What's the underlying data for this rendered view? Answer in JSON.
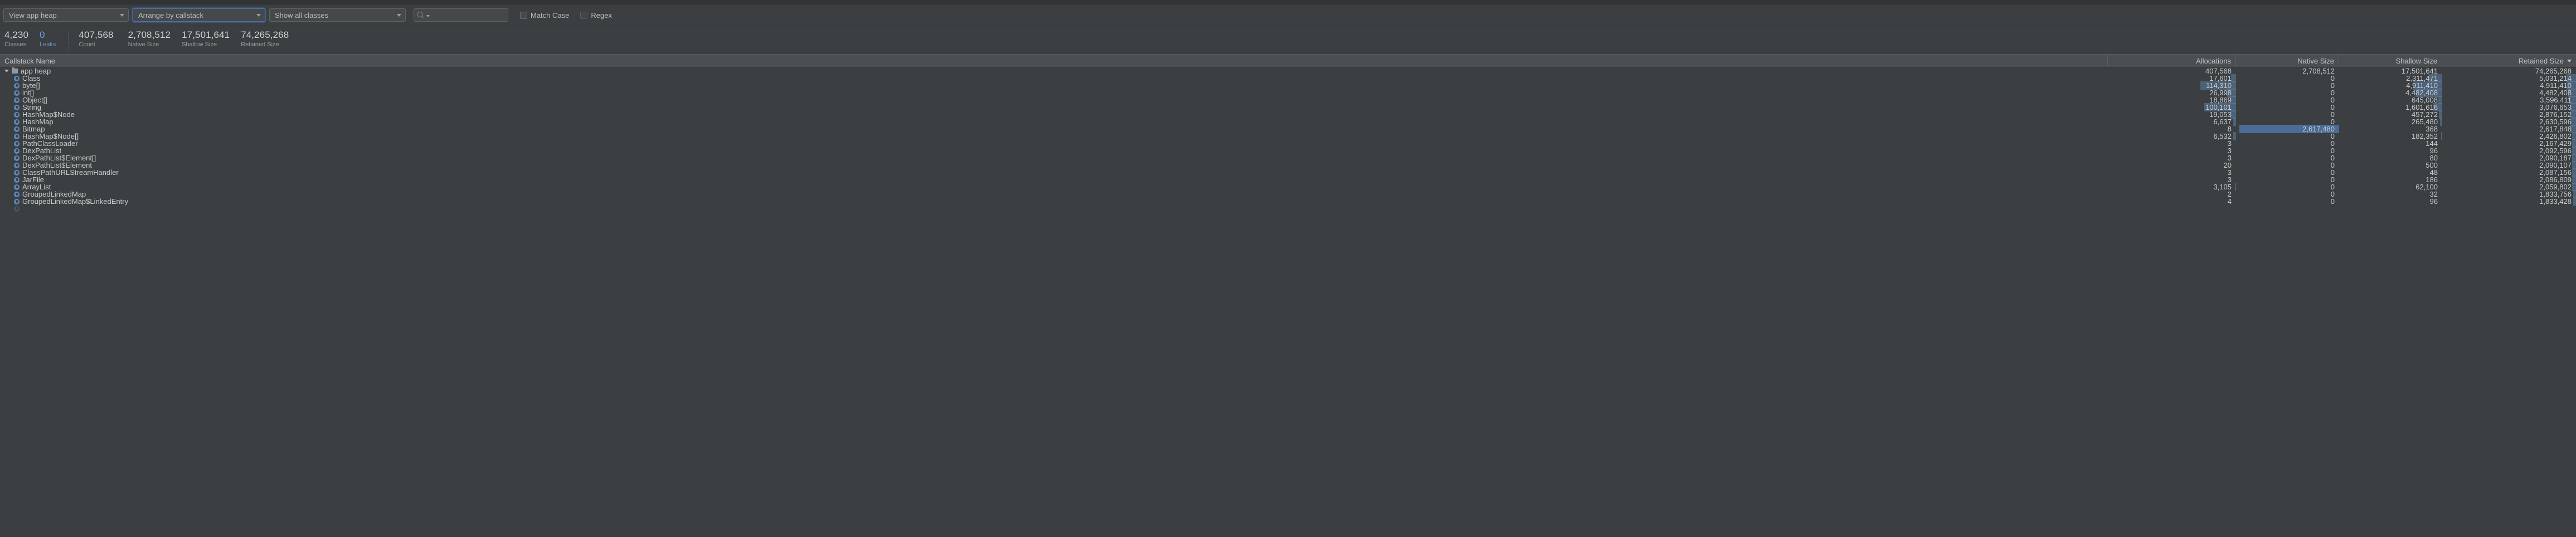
{
  "toolbar": {
    "heap_select": {
      "value": "View app heap",
      "icon": "chevron-down-icon"
    },
    "arrange_select": {
      "value": "Arrange by callstack",
      "icon": "chevron-down-icon"
    },
    "classes_select": {
      "value": "Show all classes",
      "icon": "chevron-down-icon"
    },
    "search": {
      "value": "",
      "placeholder": "",
      "icon": "search-icon"
    },
    "match_case": {
      "label": "Match Case",
      "checked": false
    },
    "regex": {
      "label": "Regex",
      "checked": false
    }
  },
  "stats": [
    {
      "value": "4,230",
      "label": "Classes",
      "accent": false
    },
    {
      "value": "0",
      "label": "Leaks",
      "accent": true
    },
    {
      "value": "407,568",
      "label": "Count",
      "accent": false
    },
    {
      "value": "2,708,512",
      "label": "Native Size",
      "accent": false
    },
    {
      "value": "17,501,641",
      "label": "Shallow Size",
      "accent": false
    },
    {
      "value": "74,265,268",
      "label": "Retained Size",
      "accent": false
    }
  ],
  "table": {
    "columns": [
      {
        "key": "name",
        "label": "Callstack Name",
        "align": "left",
        "sorted": false
      },
      {
        "key": "allocations",
        "label": "Allocations",
        "align": "right",
        "sorted": false
      },
      {
        "key": "native",
        "label": "Native Size",
        "align": "right",
        "sorted": false
      },
      {
        "key": "shallow",
        "label": "Shallow Size",
        "align": "right",
        "sorted": false
      },
      {
        "key": "retained",
        "label": "Retained Size",
        "align": "right",
        "sorted": true,
        "sort_dir": "desc"
      }
    ],
    "rows": [
      {
        "name": "app heap",
        "icon": "folder-icon",
        "depth": 0,
        "expanded": true,
        "allocations": "407,568",
        "native": "2,708,512",
        "shallow": "17,501,641",
        "retained": "74,265,268",
        "bars": {
          "allocations": 0,
          "native": 0,
          "shallow": 0,
          "retained": 0
        }
      },
      {
        "name": "Class",
        "icon": "class-icon",
        "depth": 1,
        "expanded": false,
        "allocations": "17,601",
        "native": "0",
        "shallow": "2,311,471",
        "retained": "5,031,214",
        "bars": {
          "allocations": 4,
          "native": 0,
          "shallow": 13,
          "retained": 7
        }
      },
      {
        "name": "byte[]",
        "icon": "class-icon",
        "depth": 1,
        "expanded": false,
        "allocations": "114,310",
        "native": "0",
        "shallow": "4,911,410",
        "retained": "4,911,410",
        "bars": {
          "allocations": 28,
          "native": 0,
          "shallow": 28,
          "retained": 7
        }
      },
      {
        "name": "int[]",
        "icon": "class-icon",
        "depth": 1,
        "expanded": false,
        "allocations": "26,998",
        "native": "0",
        "shallow": "4,482,408",
        "retained": "4,482,408",
        "bars": {
          "allocations": 7,
          "native": 0,
          "shallow": 26,
          "retained": 6
        }
      },
      {
        "name": "Object[]",
        "icon": "class-icon",
        "depth": 1,
        "expanded": false,
        "allocations": "18,869",
        "native": "0",
        "shallow": "645,008",
        "retained": "3,596,411",
        "bars": {
          "allocations": 5,
          "native": 0,
          "shallow": 4,
          "retained": 5
        }
      },
      {
        "name": "String",
        "icon": "class-icon",
        "depth": 1,
        "expanded": false,
        "allocations": "100,101",
        "native": "0",
        "shallow": "1,601,616",
        "retained": "3,076,653",
        "bars": {
          "allocations": 25,
          "native": 0,
          "shallow": 9,
          "retained": 4
        }
      },
      {
        "name": "HashMap$Node",
        "icon": "class-icon",
        "depth": 1,
        "expanded": false,
        "allocations": "19,053",
        "native": "0",
        "shallow": "457,272",
        "retained": "2,876,152",
        "bars": {
          "allocations": 5,
          "native": 0,
          "shallow": 3,
          "retained": 4
        }
      },
      {
        "name": "HashMap",
        "icon": "class-icon",
        "depth": 1,
        "expanded": false,
        "allocations": "6,637",
        "native": "0",
        "shallow": "265,480",
        "retained": "2,630,596",
        "bars": {
          "allocations": 2,
          "native": 0,
          "shallow": 2,
          "retained": 4
        }
      },
      {
        "name": "Bitmap",
        "icon": "class-icon",
        "depth": 1,
        "expanded": false,
        "allocations": "8",
        "native": "2,617,480",
        "shallow": "368",
        "retained": "2,617,848",
        "bars": {
          "allocations": 0,
          "native": 97,
          "shallow": 0,
          "retained": 4
        }
      },
      {
        "name": "HashMap$Node[]",
        "icon": "class-icon",
        "depth": 1,
        "expanded": false,
        "allocations": "6,532",
        "native": "0",
        "shallow": "182,352",
        "retained": "2,426,802",
        "bars": {
          "allocations": 2,
          "native": 0,
          "shallow": 1,
          "retained": 3
        }
      },
      {
        "name": "PathClassLoader",
        "icon": "class-icon",
        "depth": 1,
        "expanded": false,
        "allocations": "3",
        "native": "0",
        "shallow": "144",
        "retained": "2,167,429",
        "bars": {
          "allocations": 0,
          "native": 0,
          "shallow": 0,
          "retained": 3
        }
      },
      {
        "name": "DexPathList",
        "icon": "class-icon",
        "depth": 1,
        "expanded": false,
        "allocations": "3",
        "native": "0",
        "shallow": "96",
        "retained": "2,092,596",
        "bars": {
          "allocations": 0,
          "native": 0,
          "shallow": 0,
          "retained": 3
        }
      },
      {
        "name": "DexPathList$Element[]",
        "icon": "class-icon",
        "depth": 1,
        "expanded": false,
        "allocations": "3",
        "native": "0",
        "shallow": "80",
        "retained": "2,090,187",
        "bars": {
          "allocations": 0,
          "native": 0,
          "shallow": 0,
          "retained": 3
        }
      },
      {
        "name": "DexPathList$Element",
        "icon": "class-icon",
        "depth": 1,
        "expanded": false,
        "allocations": "20",
        "native": "0",
        "shallow": "500",
        "retained": "2,090,107",
        "bars": {
          "allocations": 0,
          "native": 0,
          "shallow": 0,
          "retained": 3
        }
      },
      {
        "name": "ClassPathURLStreamHandler",
        "icon": "class-icon",
        "depth": 1,
        "expanded": false,
        "allocations": "3",
        "native": "0",
        "shallow": "48",
        "retained": "2,087,156",
        "bars": {
          "allocations": 0,
          "native": 0,
          "shallow": 0,
          "retained": 3
        }
      },
      {
        "name": "JarFile",
        "icon": "class-icon",
        "depth": 1,
        "expanded": false,
        "allocations": "3",
        "native": "0",
        "shallow": "186",
        "retained": "2,086,809",
        "bars": {
          "allocations": 0,
          "native": 0,
          "shallow": 0,
          "retained": 3
        }
      },
      {
        "name": "ArrayList",
        "icon": "class-icon",
        "depth": 1,
        "expanded": false,
        "allocations": "3,105",
        "native": "0",
        "shallow": "62,100",
        "retained": "2,059,802",
        "bars": {
          "allocations": 1,
          "native": 0,
          "shallow": 0,
          "retained": 3
        }
      },
      {
        "name": "GroupedLinkedMap",
        "icon": "class-icon",
        "depth": 1,
        "expanded": false,
        "allocations": "2",
        "native": "0",
        "shallow": "32",
        "retained": "1,833,756",
        "bars": {
          "allocations": 0,
          "native": 0,
          "shallow": 0,
          "retained": 2
        }
      },
      {
        "name": "GroupedLinkedMap$LinkedEntry",
        "icon": "class-icon",
        "depth": 1,
        "expanded": false,
        "allocations": "4",
        "native": "0",
        "shallow": "96",
        "retained": "1,833,428",
        "bars": {
          "allocations": 0,
          "native": 0,
          "shallow": 0,
          "retained": 2
        }
      }
    ]
  }
}
